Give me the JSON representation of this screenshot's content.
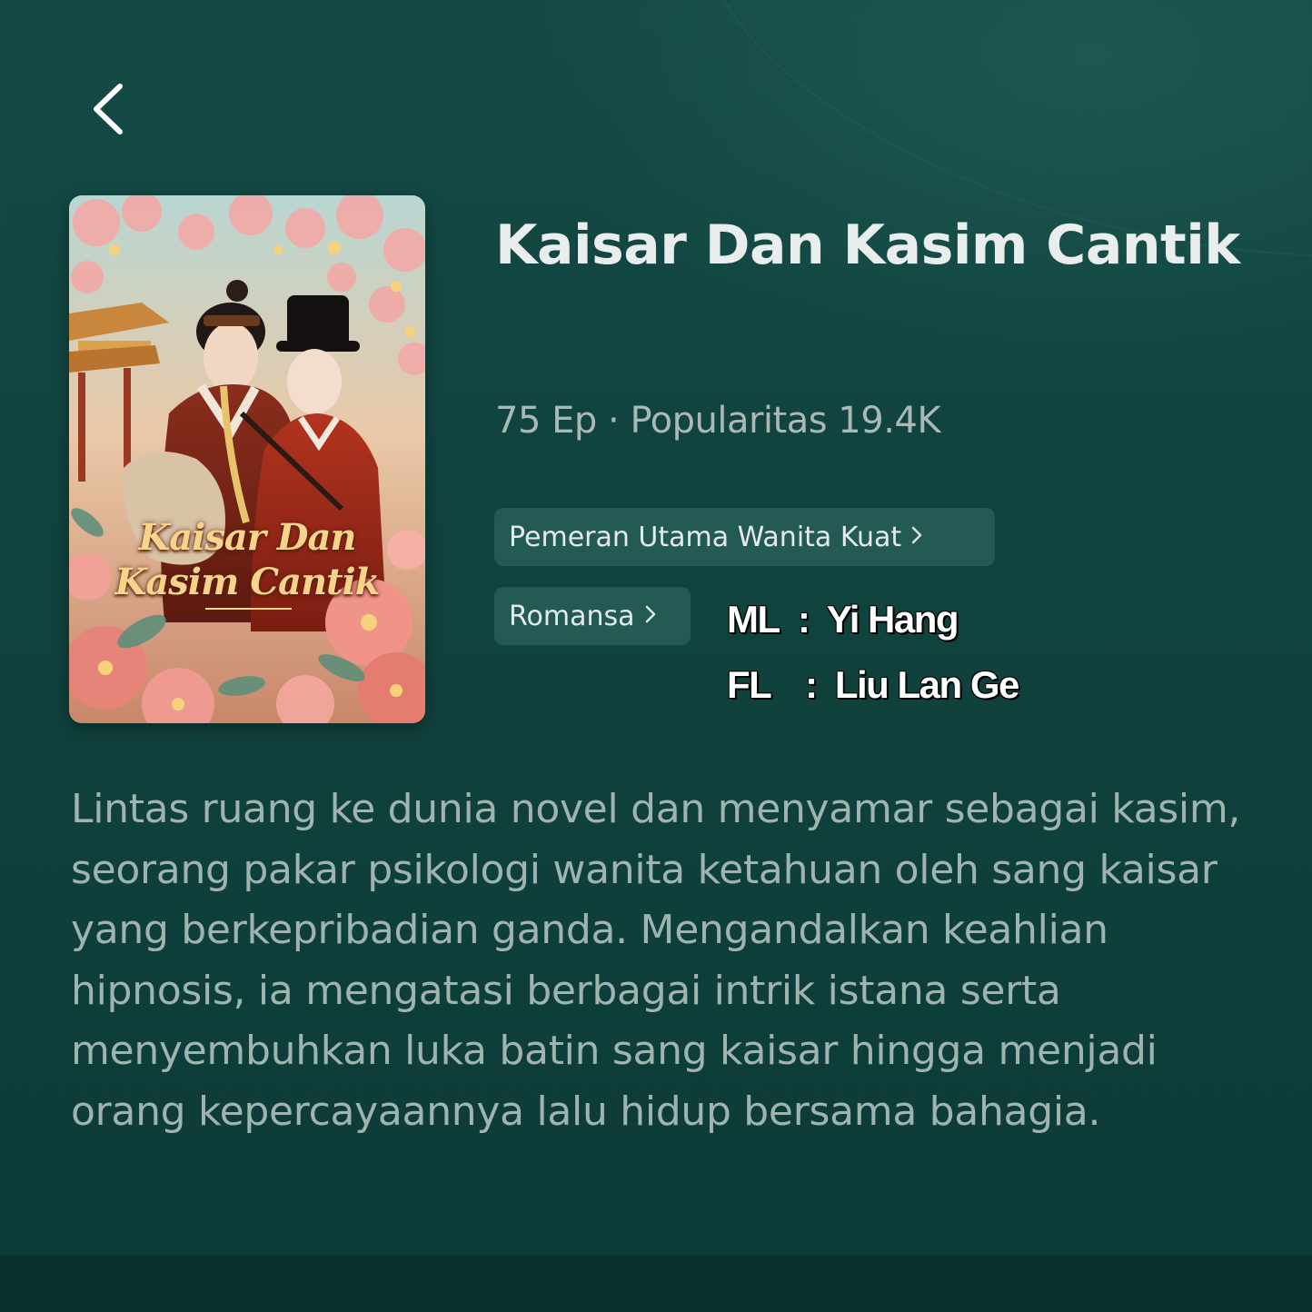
{
  "drama": {
    "title": "Kaisar Dan Kasim Cantik",
    "poster_title_line1": "Kaisar Dan",
    "poster_title_line2": "Kasim Cantik",
    "episodes": "75 Ep",
    "popularity_label": "Popularitas",
    "popularity_value": "19.4K",
    "meta_separator": "·",
    "tags": [
      {
        "label": "Pemeran Utama Wanita Kuat"
      },
      {
        "label": "Romansa"
      }
    ],
    "description": "Lintas ruang ke dunia novel dan menyamar sebagai kasim, seorang pakar psikologi wanita ketahuan oleh sang kaisar yang berkepribadian ganda. Mengandalkan keahlian hipnosis, ia mengatasi berbagai intrik istana serta menyembuhkan luka batin sang kaisar hingga menjadi orang kepercayaannya lalu hidup bersama bahagia."
  },
  "cast_overlay": {
    "ml_key": "ML",
    "ml_value": "Yi Hang",
    "fl_key": "FL",
    "fl_value": "Liu Lan Ge",
    "separator": ":"
  },
  "icons": {
    "back": "chevron-left-icon",
    "tag_arrow": "chevron-right-icon"
  },
  "colors": {
    "background": "#10423e",
    "tag_background": "#235a54",
    "title_text": "#e9eeed",
    "meta_text": "#a9b9b6",
    "description_text": "#9fb3af"
  }
}
